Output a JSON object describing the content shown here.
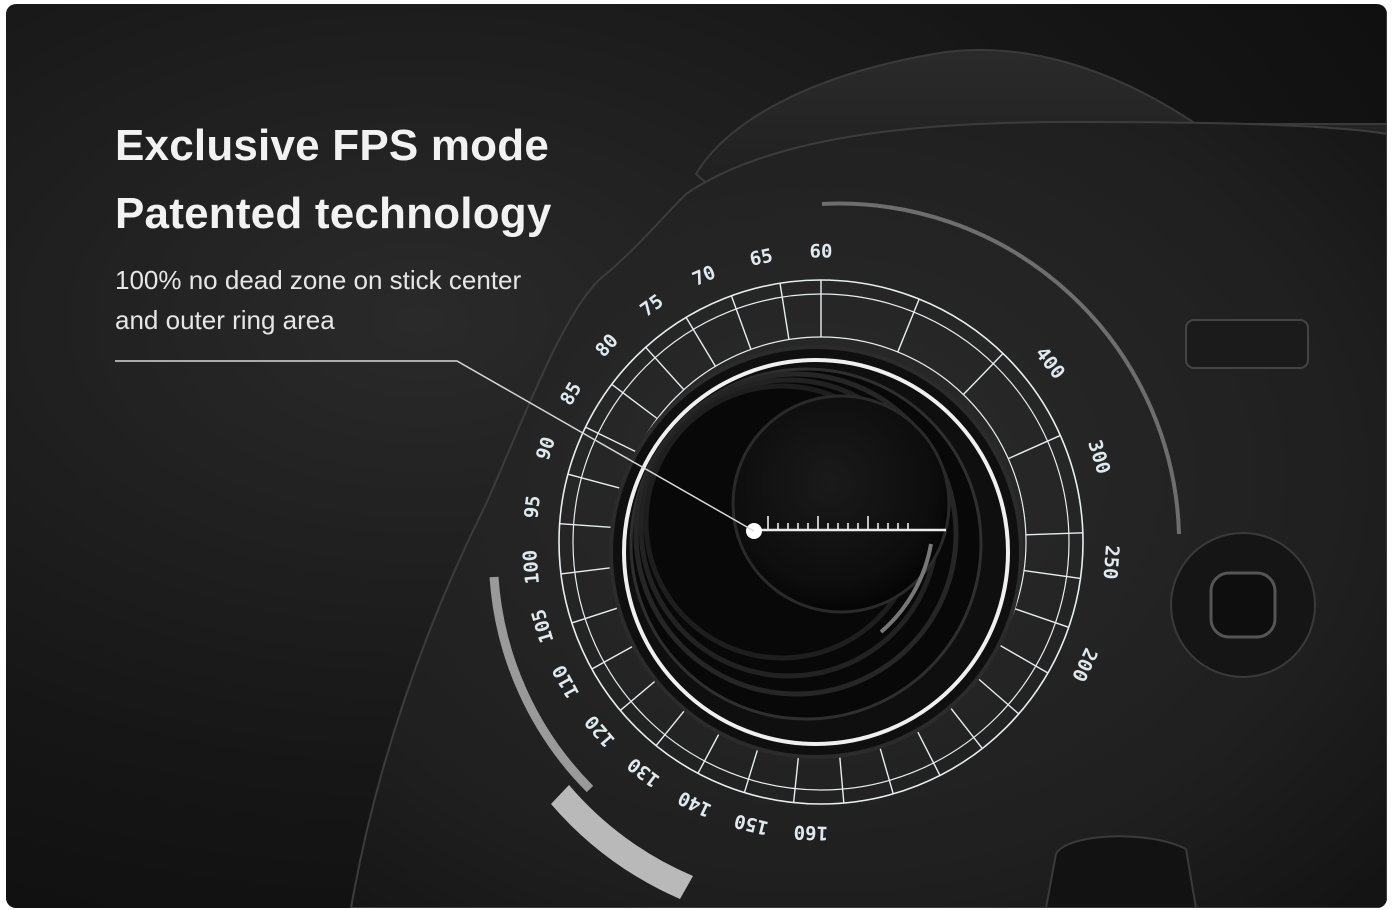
{
  "headline": {
    "line1": "Exclusive FPS mode",
    "line2": "Patented technology"
  },
  "subtitle": {
    "line1": "100% no dead zone on stick center",
    "line2": "and outer ring area"
  },
  "dial": {
    "left_scale_labels": [
      "60",
      "65",
      "70",
      "75",
      "80",
      "85",
      "90",
      "95",
      "100",
      "105",
      "110",
      "120",
      "130",
      "140",
      "150",
      "160"
    ],
    "right_scale_labels": [
      "400",
      "300",
      "250",
      "200"
    ]
  },
  "colors": {
    "background": "#161616",
    "controller_body": "#222222",
    "dial_lines": "#e8eef0",
    "text": "#f2f2f2"
  }
}
